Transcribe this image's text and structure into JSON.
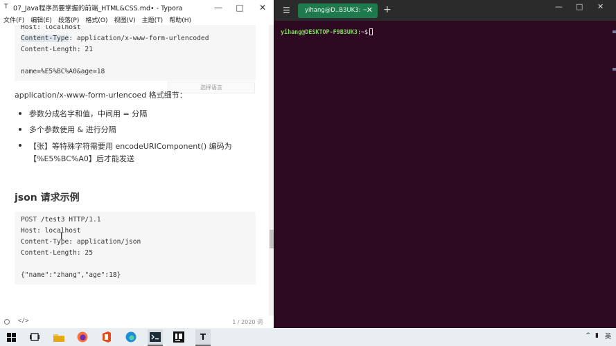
{
  "typora": {
    "title": "07_Java程序员要掌握的前端_HTML&CSS.md• - Typora",
    "menu": [
      "文件(F)",
      "编辑(E)",
      "段落(P)",
      "格式(O)",
      "视图(V)",
      "主题(T)",
      "帮助(H)"
    ],
    "code1_lines": [
      "Host: localhost",
      "Content-Type: application/x-www-form-urlencoded",
      "Content-Length: 21",
      "",
      "name=%E5%BC%A0&age=18"
    ],
    "language_select_placeholder": "选择语言",
    "paragraph": "application/x-www-form-urlencoed 格式细节：",
    "bullets": [
      "参数分成名字和值，中间用 = 分隔",
      "多个参数使用 & 进行分隔",
      "【张】等特殊字符需要用 encodeURIComponent() 编码为",
      "【%E5%BC%A0】后才能发送"
    ],
    "heading": "json 请求示例",
    "code2_lines": [
      "POST /test3 HTTP/1.1",
      "Host: localhost",
      "Content-Type: application/json",
      "Content-Length: 25",
      "",
      "{\"name\":\"zhang\",\"age\":18}"
    ],
    "status": {
      "source_toggle": "</>",
      "word_count": "1 / 2020 词"
    }
  },
  "terminal": {
    "tab_title": "yihang@D..B3UK3: ~",
    "prompt_user": "yihang@DESKTOP-F9B3UK3",
    "prompt_path": ":~$"
  },
  "taskbar": {
    "icons": [
      "windows-start",
      "task-view",
      "file-explorer",
      "firefox",
      "office",
      "edge",
      "terminal",
      "intellij",
      "typora"
    ],
    "tray_language": "英"
  },
  "colors": {
    "terminal_bg": "#2d0a22",
    "terminal_tab": "#1e7a4c",
    "prompt_user": "#7ed957",
    "code_bg": "#f6f6f6"
  }
}
